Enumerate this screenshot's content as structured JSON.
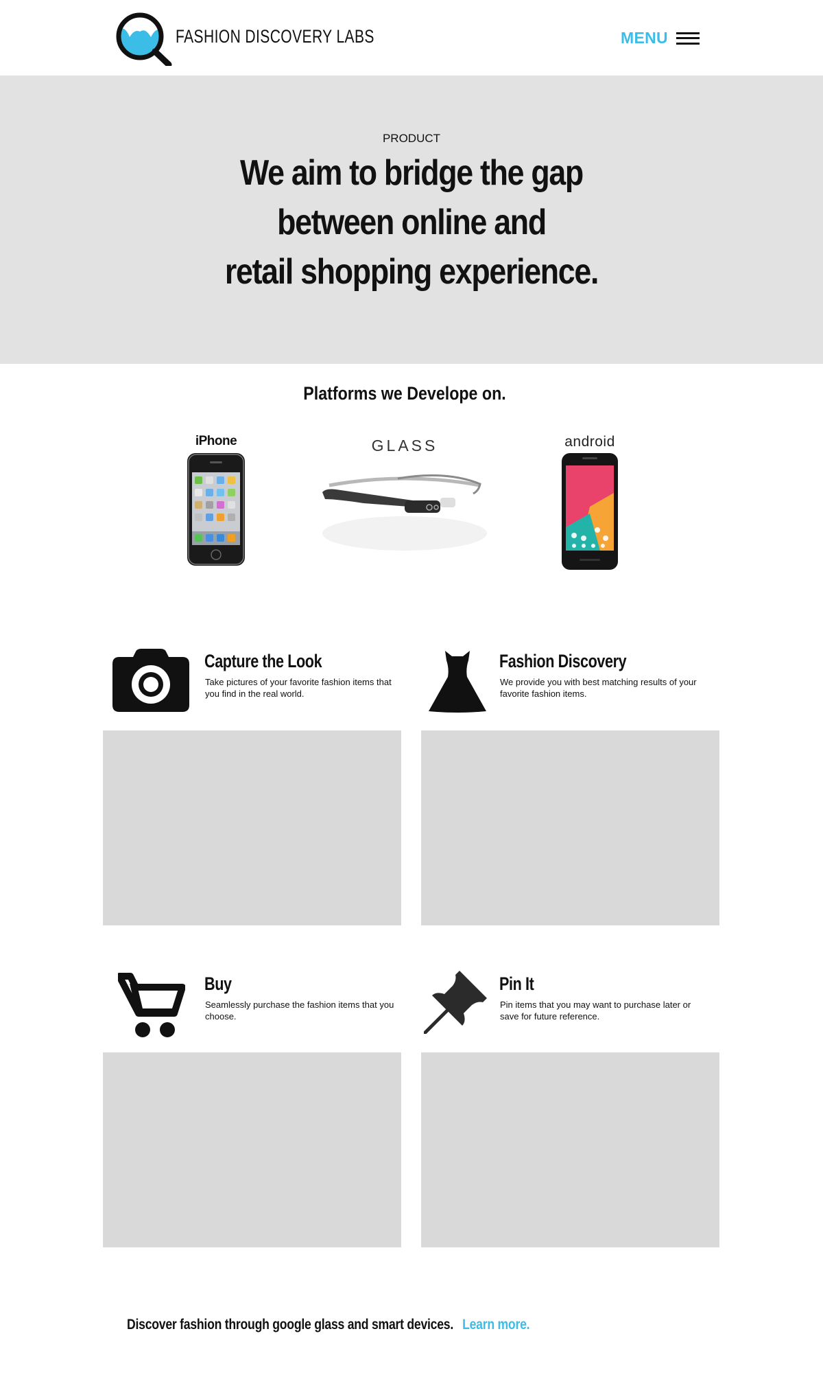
{
  "header": {
    "brand": "FASHION DISCOVERY LABS",
    "menu_label": "MENU",
    "icons": {
      "logo": "magnifier-logo-icon",
      "menu": "hamburger-icon"
    },
    "colors": {
      "accent": "#3cbde8"
    }
  },
  "hero": {
    "eyebrow": "PRODUCT",
    "title_lines": [
      "We aim to bridge the gap",
      "between online and",
      "retail shopping experience."
    ],
    "background": "#e2e2e2"
  },
  "platforms": {
    "title": "Platforms we Develope on.",
    "items": [
      {
        "label": "iPhone",
        "icon": "iphone-device-icon"
      },
      {
        "label": "GLASS",
        "icon": "google-glass-icon"
      },
      {
        "label": "android",
        "icon": "android-phone-icon"
      }
    ]
  },
  "features": [
    {
      "title": "Capture the Look",
      "description": "Take pictures of your favorite fashion items that you find in the real world.",
      "icon": "camera-icon"
    },
    {
      "title": "Fashion Discovery",
      "description": "We provide you with best matching results of your favorite fashion items.",
      "icon": "dress-icon"
    },
    {
      "title": "Buy",
      "description": "Seamlessly purchase the fashion items that you choose.",
      "icon": "cart-icon"
    },
    {
      "title": "Pin It",
      "description": "Pin items that you may want to purchase later or save for future reference.",
      "icon": "pushpin-icon"
    }
  ],
  "footer": {
    "text": "Discover fashion through google glass and smart devices.",
    "link_label": "Learn more."
  }
}
